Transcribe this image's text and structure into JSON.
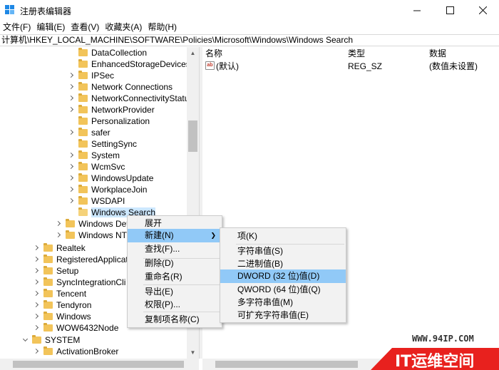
{
  "window": {
    "title": "注册表编辑器",
    "min_icon": "minimize-icon",
    "max_icon": "maximize-icon",
    "close_icon": "close-icon"
  },
  "menu": [
    "文件(F)",
    "编辑(E)",
    "查看(V)",
    "收藏夹(A)",
    "帮助(H)"
  ],
  "address": "计算机\\HKEY_LOCAL_MACHINE\\SOFTWARE\\Policies\\Microsoft\\Windows\\Windows Search",
  "tree": {
    "items": [
      {
        "label": "DataCollection"
      },
      {
        "label": "EnhancedStorageDevices"
      },
      {
        "label": "IPSec"
      },
      {
        "label": "Network Connections"
      },
      {
        "label": "NetworkConnectivityStatu"
      },
      {
        "label": "NetworkProvider"
      },
      {
        "label": "Personalization"
      },
      {
        "label": "safer"
      },
      {
        "label": "SettingSync"
      },
      {
        "label": "System"
      },
      {
        "label": "WcmSvc"
      },
      {
        "label": "WindowsUpdate"
      },
      {
        "label": "WorkplaceJoin"
      },
      {
        "label": "WSDAPI"
      },
      {
        "label": "Windows Search"
      },
      {
        "label": "Windows Def"
      },
      {
        "label": "Windows NT"
      },
      {
        "label": "Realtek"
      },
      {
        "label": "RegisteredApplicat"
      },
      {
        "label": "Setup"
      },
      {
        "label": "SyncIntegrationCli"
      },
      {
        "label": "Tencent"
      },
      {
        "label": "Tendyron"
      },
      {
        "label": "Windows"
      },
      {
        "label": "WOW6432Node"
      },
      {
        "label": "SYSTEM"
      },
      {
        "label": "ActivationBroker"
      }
    ]
  },
  "list": {
    "headers": {
      "name": "名称",
      "type": "类型",
      "data": "数据"
    },
    "rows": [
      {
        "icon": "ab",
        "name": "(默认)",
        "type": "REG_SZ",
        "data": "(数值未设置)"
      }
    ]
  },
  "context_menu": {
    "items": [
      "展开",
      "新建(N)",
      "查找(F)...",
      "删除(D)",
      "重命名(R)",
      "导出(E)",
      "权限(P)...",
      "复制项名称(C)"
    ],
    "highlighted": "新建(N)",
    "submenu_arrow": "❯"
  },
  "submenu": {
    "items": [
      "项(K)",
      "字符串值(S)",
      "二进制值(B)",
      "DWORD (32 位)值(D)",
      "QWORD (64 位)值(Q)",
      "多字符串值(M)",
      "可扩充字符串值(E)"
    ],
    "highlighted": "DWORD (32 位)值(D)"
  },
  "watermark": {
    "url": "WWW.94IP.COM",
    "brand": "IT运维空间",
    "color": "#e8211e"
  }
}
